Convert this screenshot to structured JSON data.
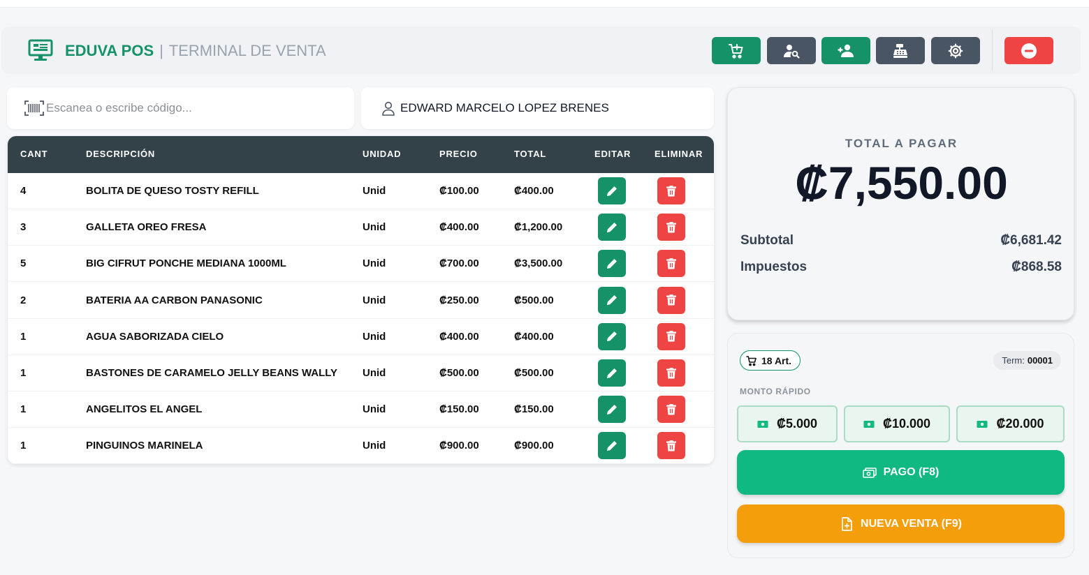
{
  "header": {
    "brand": "EDUVA POS",
    "separator": "|",
    "subtitle": "TERMINAL DE VENTA",
    "buttons": [
      {
        "icon": "cart-plus-icon",
        "color": "#159267"
      },
      {
        "icon": "user-search-icon",
        "color": "#4a5563"
      },
      {
        "icon": "user-plus-icon",
        "color": "#159267"
      },
      {
        "icon": "cash-register-icon",
        "color": "#4a5563"
      },
      {
        "icon": "gear-icon",
        "color": "#4a5563"
      },
      {
        "icon": "minus-circle-icon",
        "color": "#ef4444"
      }
    ]
  },
  "search": {
    "placeholder": "Escanea o escribe código...",
    "value": ""
  },
  "client": {
    "name": "EDWARD MARCELO LOPEZ BRENES"
  },
  "table": {
    "columns": [
      "CANT",
      "DESCRIPCIÓN",
      "UNIDAD",
      "PRECIO",
      "TOTAL",
      "EDITAR",
      "ELIMINAR"
    ],
    "rows": [
      {
        "cant": "4",
        "desc": "BOLITA DE QUESO TOSTY REFILL",
        "unit": "Unid",
        "price": "₡100.00",
        "total": "₡400.00"
      },
      {
        "cant": "3",
        "desc": "GALLETA OREO FRESA",
        "unit": "Unid",
        "price": "₡400.00",
        "total": "₡1,200.00"
      },
      {
        "cant": "5",
        "desc": "BIG CIFRUT PONCHE MEDIANA 1000ML",
        "unit": "Unid",
        "price": "₡700.00",
        "total": "₡3,500.00"
      },
      {
        "cant": "2",
        "desc": "BATERIA AA CARBON PANASONIC",
        "unit": "Unid",
        "price": "₡250.00",
        "total": "₡500.00"
      },
      {
        "cant": "1",
        "desc": "AGUA SABORIZADA CIELO",
        "unit": "Unid",
        "price": "₡400.00",
        "total": "₡400.00"
      },
      {
        "cant": "1",
        "desc": "BASTONES DE CARAMELO JELLY BEANS WALLY",
        "unit": "Unid",
        "price": "₡500.00",
        "total": "₡500.00"
      },
      {
        "cant": "1",
        "desc": "ANGELITOS EL ANGEL",
        "unit": "Unid",
        "price": "₡150.00",
        "total": "₡150.00"
      },
      {
        "cant": "1",
        "desc": "PINGUINOS MARINELA",
        "unit": "Unid",
        "price": "₡900.00",
        "total": "₡900.00"
      }
    ]
  },
  "totals": {
    "label": "TOTAL A PAGAR",
    "value": "₡7,550.00",
    "subtotal_label": "Subtotal",
    "subtotal_value": "₡6,681.42",
    "tax_label": "Impuestos",
    "tax_value": "₡868.58"
  },
  "panel": {
    "articles": "18 Art.",
    "term_label": "Term:",
    "term_value": "00001",
    "quick_label": "MONTO RÁPIDO",
    "quick_amounts": [
      "₡5.000",
      "₡10.000",
      "₡20.000"
    ],
    "pay_label": "PAGO (F8)",
    "new_sale_label": "NUEVA VENTA (F9)"
  },
  "colors": {
    "brand_green": "#159267",
    "table_header": "#334149",
    "delete_red": "#ef4444",
    "pay_green": "#10b981",
    "new_sale_orange": "#f59e0b"
  }
}
